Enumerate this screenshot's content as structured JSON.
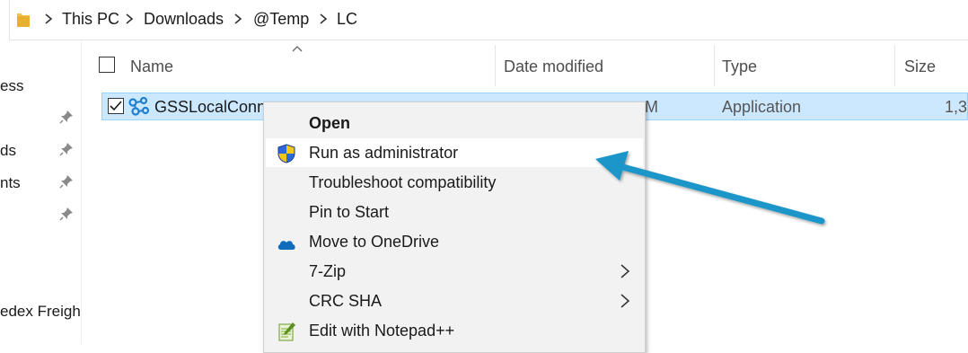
{
  "breadcrumb": [
    "This PC",
    "Downloads",
    "@Temp",
    "LC"
  ],
  "nav": {
    "items": [
      "ess",
      "ds",
      "nts",
      "edex Freigh"
    ]
  },
  "columns": {
    "name": "Name",
    "date": "Date modified",
    "type": "Type",
    "size": "Size"
  },
  "file": {
    "name": "GSSLocalConne",
    "date_fragment": "M",
    "type": "Application",
    "size": "1,3"
  },
  "context_menu": {
    "items": [
      {
        "label": "Open",
        "icon": "none",
        "bold": true
      },
      {
        "label": "Run as administrator",
        "icon": "uac-shield-icon",
        "highlighted": true
      },
      {
        "label": "Troubleshoot compatibility",
        "icon": "none"
      },
      {
        "label": "Pin to Start",
        "icon": "none"
      },
      {
        "label": "Move to OneDrive",
        "icon": "onedrive-cloud-icon"
      },
      {
        "label": "7-Zip",
        "icon": "none",
        "submenu": true
      },
      {
        "label": "CRC SHA",
        "icon": "none",
        "submenu": true
      },
      {
        "label": "Edit with Notepad++",
        "icon": "notepadpp-icon"
      }
    ]
  },
  "colors": {
    "selection": "#cce8ff",
    "annotation_arrow": "#1a96c8"
  }
}
